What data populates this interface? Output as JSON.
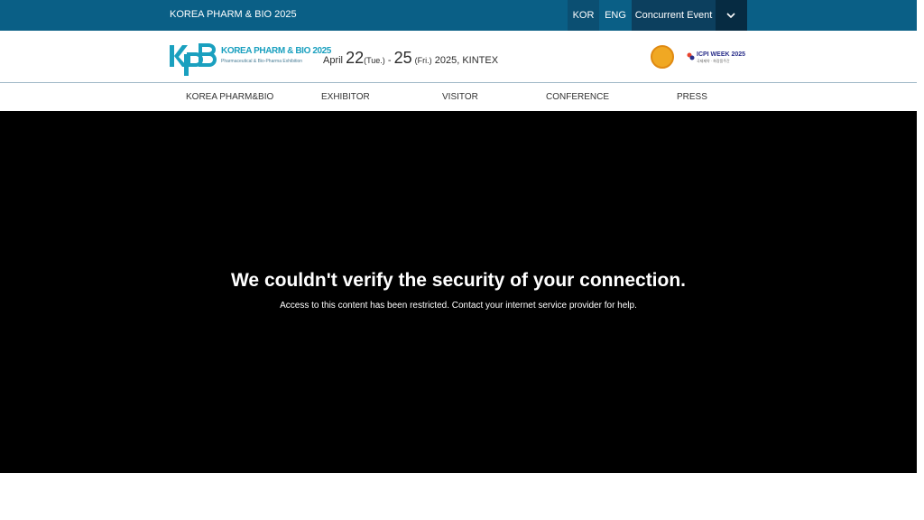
{
  "topbar": {
    "site_title": "KOREA PHARM & BIO 2025",
    "lang_kor": "KOR",
    "lang_eng": "ENG",
    "concurrent_event": "Concurrent Event",
    "chevron_icon": "chevron-down-icon"
  },
  "header": {
    "logo": {
      "name": "KOREA PHARM & BIO 2025",
      "subtitle": "Pharmaceutical & Bio-Pharma Exhibition"
    },
    "date": {
      "month": "April",
      "start_day": "22",
      "start_weekday": "(Tue.)",
      "separator": "-",
      "end_day": "25",
      "end_weekday": "(Fri.)",
      "year_venue": "2025, KINTEX"
    },
    "partner_badge_icon": "circle-emblem-icon",
    "icpi": {
      "name": "ICPI WEEK 2025",
      "subtitle": "국제제약 · 화장품주간"
    }
  },
  "nav": {
    "items": [
      {
        "label": "KOREA PHARM&BIO"
      },
      {
        "label": "EXHIBITOR"
      },
      {
        "label": "VISITOR"
      },
      {
        "label": "CONFERENCE"
      },
      {
        "label": "PRESS"
      }
    ]
  },
  "error": {
    "title": "We couldn't verify the security of your connection.",
    "message": "Access to this content has been restricted. Contact your internet service provider for help."
  },
  "colors": {
    "topbar": "#0a5f86",
    "topbar_dark": "#0c3f5e",
    "brand_teal": "#1aa0bf",
    "error_bg": "#000000"
  }
}
